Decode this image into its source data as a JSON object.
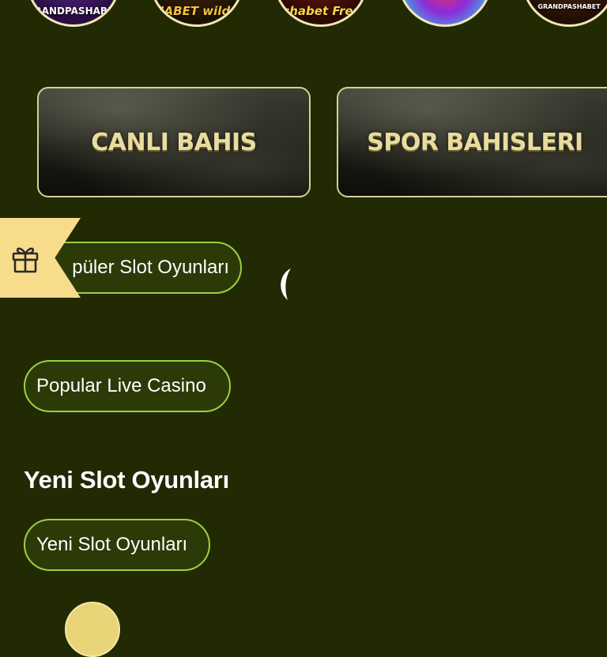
{
  "games": [
    {
      "name": "GRANDPASHABET"
    },
    {
      "name": "PASHABET wild cash"
    },
    {
      "name": "Grandpashabet Frenzy fruits"
    },
    {
      "name": ""
    },
    {
      "name": "GRANDPASHABET"
    }
  ],
  "banners": {
    "left_label": "CANLI BAHIS",
    "right_label": "SPOR BAHISLERI"
  },
  "sections": {
    "popular_slots_button": "püler Slot Oyunları",
    "popular_live_casino_button": "Popular Live Casino",
    "new_slots_heading": "Yeni Slot Oyunları",
    "new_slots_button": "Yeni Slot Oyunları"
  },
  "icons": {
    "gift": "gift-icon",
    "spinner": "loading-spinner-icon"
  },
  "colors": {
    "background": "#222a03",
    "pill_border": "#9bd140",
    "pill_fill": "#2c3a08",
    "gift_tab": "#f7dc8c",
    "banner_text": "#e9dca0"
  }
}
